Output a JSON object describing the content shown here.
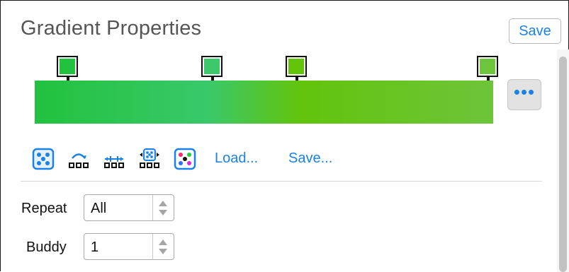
{
  "panel": {
    "title": "Gradient Properties",
    "save_label": "Save"
  },
  "gradient": {
    "stops": [
      {
        "name": "stop-1",
        "color": "#22c23f"
      },
      {
        "name": "stop-2",
        "color": "#3ec86c"
      },
      {
        "name": "stop-3",
        "color": "#62c40b"
      },
      {
        "name": "stop-4",
        "color": "#6dc53d"
      }
    ],
    "more_label": "•••"
  },
  "toolbar": {
    "icons": [
      "randomize-dice-icon",
      "reverse-stops-icon",
      "distribute-stops-icon",
      "spread-stops-icon",
      "random-colors-dice-icon"
    ],
    "load_label": "Load...",
    "save_label": "Save..."
  },
  "fields": {
    "repeat": {
      "label": "Repeat",
      "value": "All"
    },
    "buddy": {
      "label": "Buddy",
      "value": "1"
    }
  },
  "colors": {
    "accent": "#1a82e6",
    "title_gray": "#555555"
  }
}
